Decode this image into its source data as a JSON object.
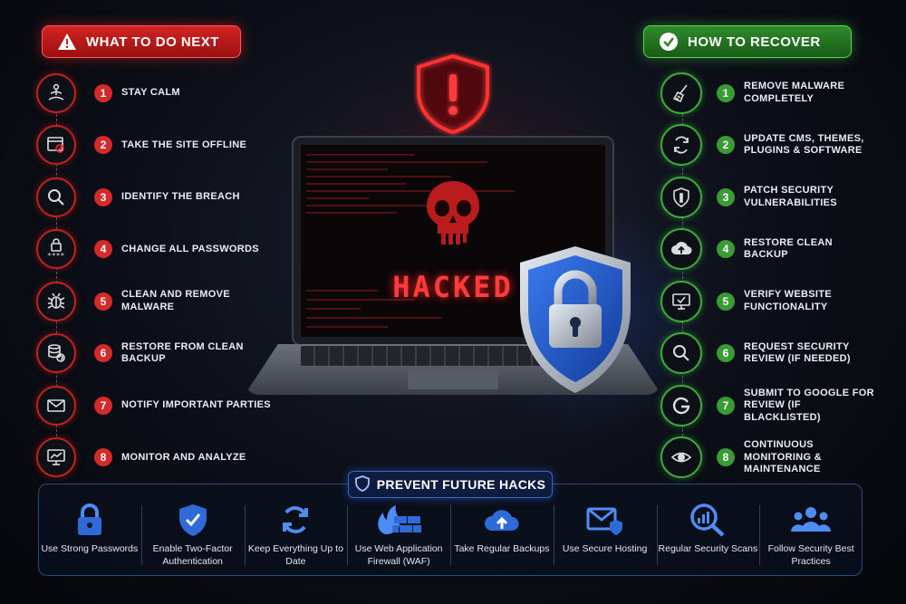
{
  "left_panel": {
    "title": "WHAT TO DO NEXT",
    "steps": [
      {
        "num": "1",
        "label": "STAY CALM",
        "icon": "meditation-icon"
      },
      {
        "num": "2",
        "label": "TAKE THE SITE OFFLINE",
        "icon": "browser-blocked-icon"
      },
      {
        "num": "3",
        "label": "IDENTIFY THE BREACH",
        "icon": "magnifier-icon"
      },
      {
        "num": "4",
        "label": "CHANGE ALL PASSWORDS",
        "icon": "password-lock-icon"
      },
      {
        "num": "5",
        "label": "CLEAN AND REMOVE MALWARE",
        "icon": "bug-icon"
      },
      {
        "num": "6",
        "label": "RESTORE FROM CLEAN BACKUP",
        "icon": "database-restore-icon"
      },
      {
        "num": "7",
        "label": "NOTIFY IMPORTANT PARTIES",
        "icon": "envelope-icon"
      },
      {
        "num": "8",
        "label": "MONITOR AND ANALYZE",
        "icon": "monitor-chart-icon"
      }
    ]
  },
  "right_panel": {
    "title": "HOW TO RECOVER",
    "steps": [
      {
        "num": "1",
        "label": "REMOVE MALWARE COMPLETELY",
        "icon": "broom-icon"
      },
      {
        "num": "2",
        "label": "UPDATE CMS, THEMES, PLUGINS & SOFTWARE",
        "icon": "refresh-icon"
      },
      {
        "num": "3",
        "label": "PATCH SECURITY VULNERABILITIES",
        "icon": "shield-icon"
      },
      {
        "num": "4",
        "label": "RESTORE CLEAN BACKUP",
        "icon": "cloud-upload-icon"
      },
      {
        "num": "5",
        "label": "VERIFY WEBSITE FUNCTIONALITY",
        "icon": "monitor-check-icon"
      },
      {
        "num": "6",
        "label": "REQUEST SECURITY REVIEW (IF NEEDED)",
        "icon": "magnifier-icon"
      },
      {
        "num": "7",
        "label": "SUBMIT TO GOOGLE FOR REVIEW (IF BLACKLISTED)",
        "icon": "google-icon"
      },
      {
        "num": "8",
        "label": "CONTINUOUS MONITORING & MAINTENANCE",
        "icon": "eye-icon"
      }
    ]
  },
  "center": {
    "screen_text": "HACKED"
  },
  "prevent": {
    "title": "PREVENT FUTURE HACKS",
    "items": [
      {
        "label": "Use Strong Passwords",
        "icon": "padlock-icon"
      },
      {
        "label": "Enable Two-Factor Authentication",
        "icon": "shield-check-icon"
      },
      {
        "label": "Keep Everything Up to Date",
        "icon": "sync-icon"
      },
      {
        "label": "Use Web Application Firewall (WAF)",
        "icon": "firewall-icon"
      },
      {
        "label": "Take Regular Backups",
        "icon": "cloud-backup-icon"
      },
      {
        "label": "Use Secure Hosting",
        "icon": "secure-mail-icon"
      },
      {
        "label": "Regular Security Scans",
        "icon": "scan-chart-icon"
      },
      {
        "label": "Follow Security Best Practices",
        "icon": "team-icon"
      }
    ]
  },
  "colors": {
    "red": "#d22424",
    "green": "#3a9a35",
    "blue": "#2f6bd8"
  }
}
